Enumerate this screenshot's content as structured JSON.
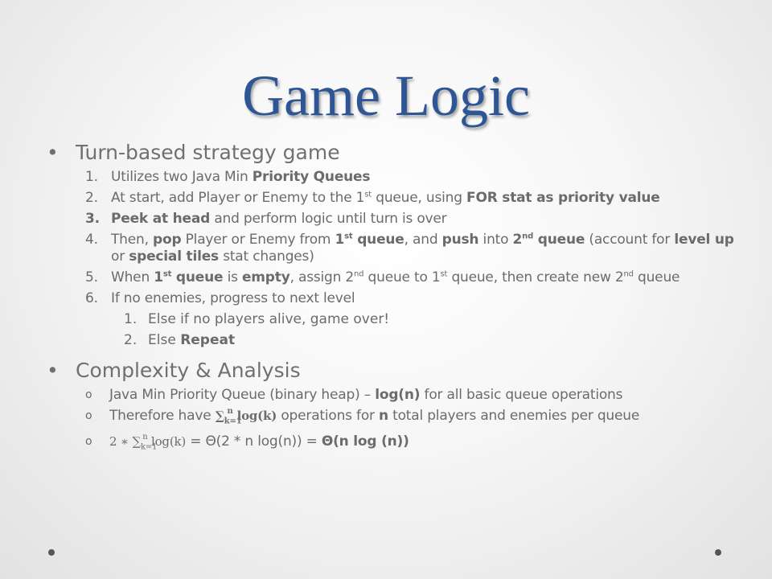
{
  "slide": {
    "title": "Game Logic",
    "sections": [
      {
        "marker": "•",
        "text": "Turn-based strategy game",
        "items": [
          {
            "marker": "1.",
            "level": 2,
            "segs": [
              {
                "t": "Utilizes two Java Min "
              },
              {
                "t": "Priority Queues",
                "b": true
              }
            ]
          },
          {
            "marker": "2.",
            "level": 2,
            "segs": [
              {
                "t": "At start, add Player or Enemy to the 1"
              },
              {
                "t": "st",
                "sup": true
              },
              {
                "t": " queue, using "
              },
              {
                "t": "FOR stat as priority value",
                "b": true
              }
            ]
          },
          {
            "marker": "3.",
            "level": 2,
            "boldMarker": true,
            "segs": [
              {
                "t": "Peek at head",
                "b": true
              },
              {
                "t": " and perform logic until turn is over"
              }
            ]
          },
          {
            "marker": "4.",
            "level": 2,
            "segs": [
              {
                "t": "Then, "
              },
              {
                "t": "pop",
                "b": true
              },
              {
                "t": " Player or Enemy from "
              },
              {
                "t": "1",
                "b": true
              },
              {
                "t": "st",
                "sup": true,
                "b": true
              },
              {
                "t": " queue",
                "b": true
              },
              {
                "t": ", and "
              },
              {
                "t": "push",
                "b": true
              },
              {
                "t": " into "
              },
              {
                "t": "2",
                "b": true
              },
              {
                "t": "nd",
                "sup": true,
                "b": true
              },
              {
                "t": " queue",
                "b": true
              },
              {
                "t": " (account for "
              },
              {
                "t": "level up",
                "b": true
              },
              {
                "t": " or "
              },
              {
                "t": "special tiles",
                "b": true
              },
              {
                "t": " stat changes)"
              }
            ]
          },
          {
            "marker": "5.",
            "level": 2,
            "segs": [
              {
                "t": "When "
              },
              {
                "t": "1",
                "b": true
              },
              {
                "t": "st",
                "sup": true,
                "b": true
              },
              {
                "t": " queue",
                "b": true
              },
              {
                "t": " is "
              },
              {
                "t": "empty",
                "b": true
              },
              {
                "t": ", assign 2"
              },
              {
                "t": "nd",
                "sup": true
              },
              {
                "t": " queue to 1"
              },
              {
                "t": "st",
                "sup": true
              },
              {
                "t": " queue, then create new 2"
              },
              {
                "t": "nd",
                "sup": true
              },
              {
                "t": " queue"
              }
            ]
          },
          {
            "marker": "6.",
            "level": 2,
            "segs": [
              {
                "t": "If no enemies, progress to next level"
              }
            ]
          },
          {
            "marker": "1.",
            "level": 3,
            "segs": [
              {
                "t": "Else if no players alive, game over!"
              }
            ]
          },
          {
            "marker": "2.",
            "level": 3,
            "segs": [
              {
                "t": "Else "
              },
              {
                "t": "Repeat",
                "b": true
              }
            ]
          }
        ]
      },
      {
        "marker": "•",
        "text": "Complexity & Analysis",
        "items": [
          {
            "marker": "o",
            "level": 2,
            "o": true,
            "segs": [
              {
                "t": "Java Min Priority Queue (binary heap) – "
              },
              {
                "t": "log(n)",
                "b": true
              },
              {
                "t": " for all basic queue operations"
              }
            ]
          },
          {
            "marker": "o",
            "level": 2,
            "o": true,
            "segs": [
              {
                "t": "Therefore have "
              },
              {
                "t": "∑",
                "math": true,
                "b": true
              },
              {
                "t": "k=1",
                "sub": true,
                "b": true
              },
              {
                "t": "n",
                "supm": true,
                "b": true
              },
              {
                "t": " log(k)",
                "math": true,
                "b": true
              },
              {
                "t": "  operations for "
              },
              {
                "t": "n",
                "b": true
              },
              {
                "t": " total players and enemies per queue"
              }
            ]
          },
          {
            "marker": "o",
            "level": 2,
            "o": true,
            "segs": [
              {
                "t": "2 ∗ ∑",
                "math": true
              },
              {
                "t": "k=1",
                "sub": true
              },
              {
                "t": "n",
                "supm": true
              },
              {
                "t": " log(k)",
                "math": true
              },
              {
                "t": "  = Θ(2 * n log(n)) = "
              },
              {
                "t": "Θ(n log (n))",
                "b": true
              }
            ]
          }
        ]
      }
    ],
    "colors": {
      "title": "#2e5594",
      "text": "#6b6b6b",
      "dots": "#555555"
    }
  }
}
